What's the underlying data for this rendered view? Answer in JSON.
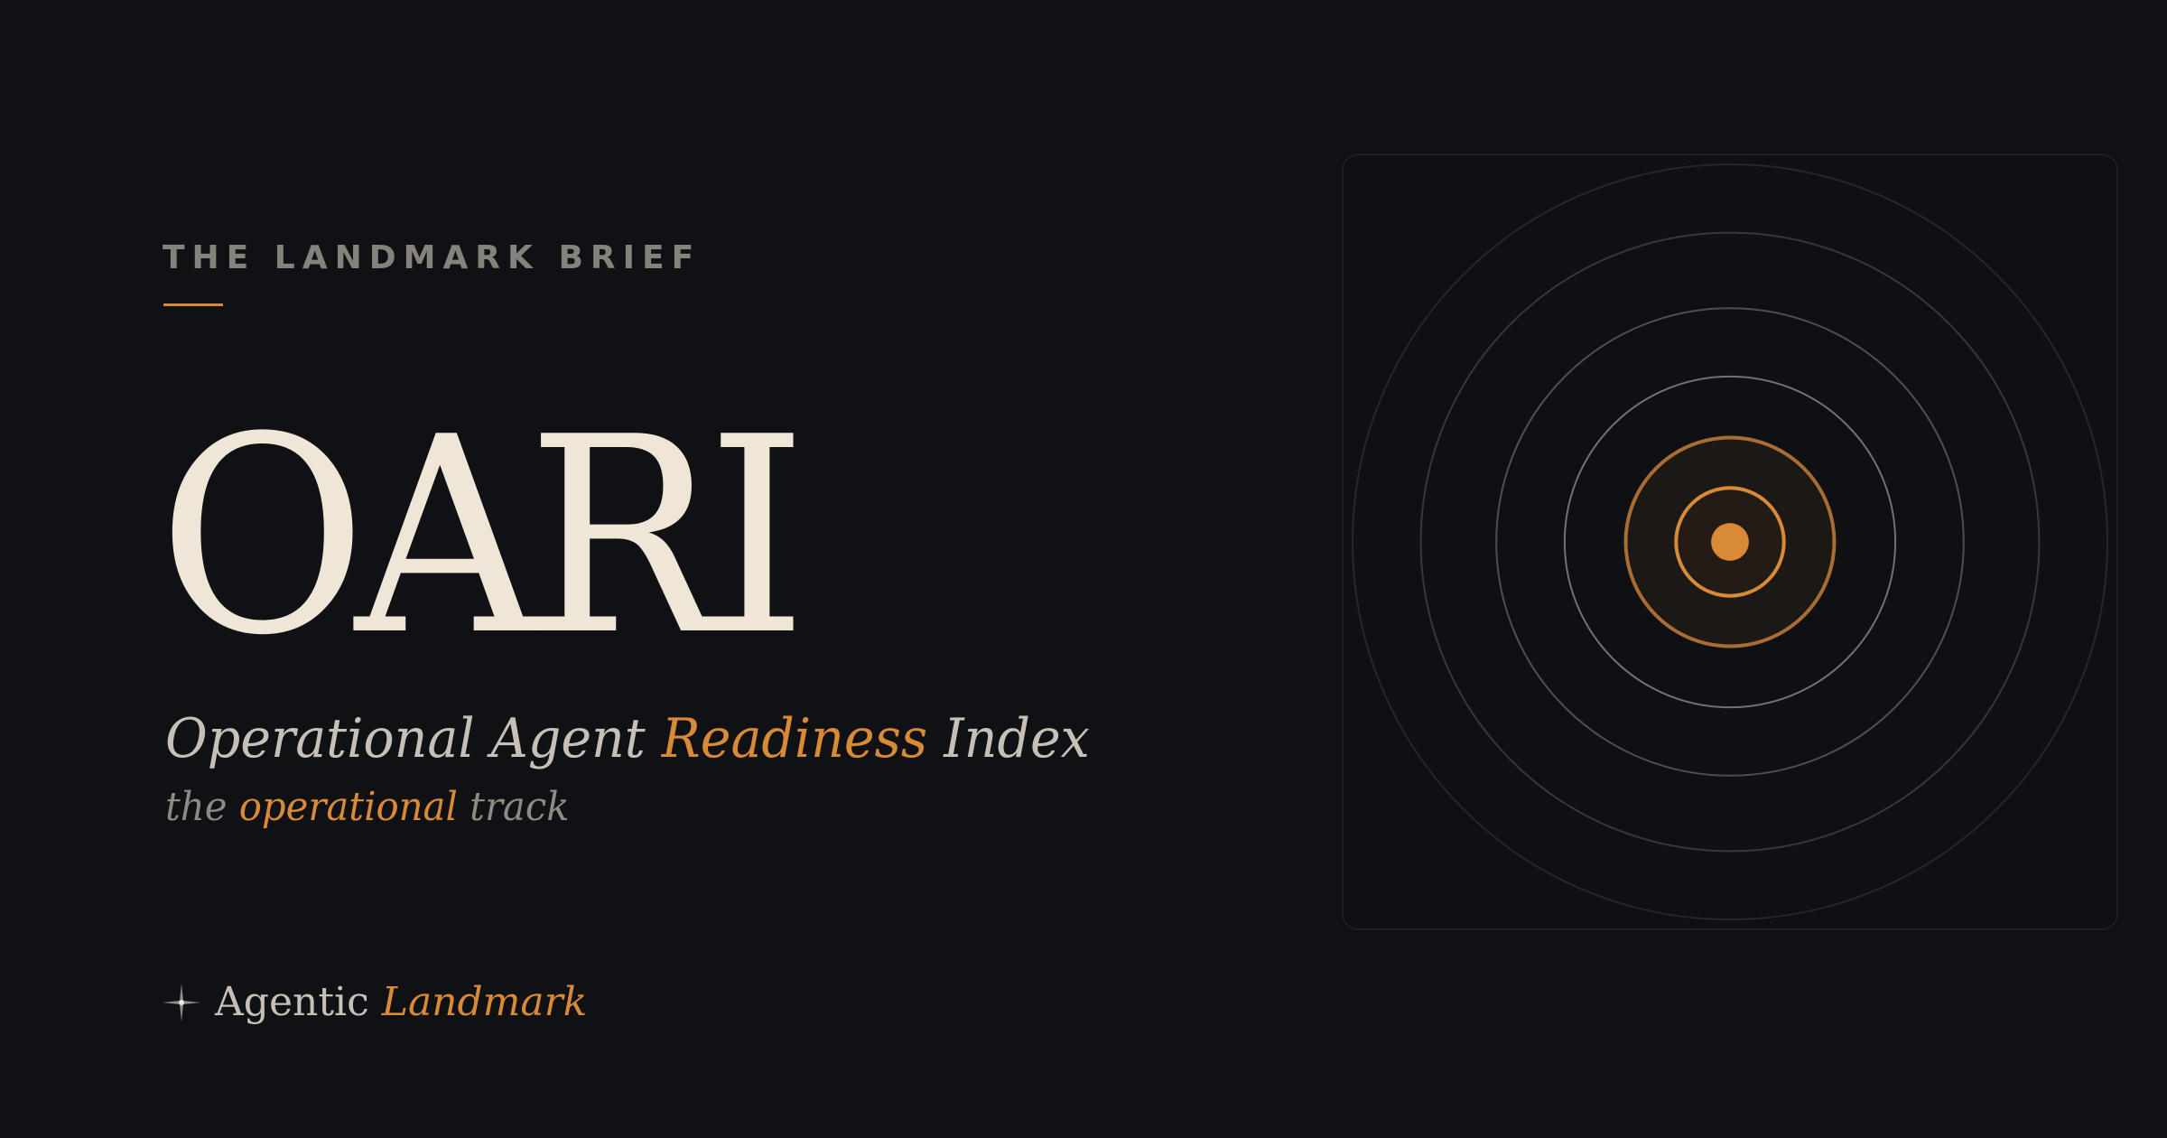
{
  "eyebrow": "THE LANDMARK BRIEF",
  "headline": "OARI",
  "subtitle": {
    "part1": "Operational Agent ",
    "accent": "Readiness",
    "part2": " Index"
  },
  "tagline": {
    "part1": "the ",
    "accent": "operational",
    "part2": " track"
  },
  "brand": {
    "icon": "sparkle-star-icon",
    "name": "Agentic",
    "accent": "Landmark"
  },
  "graphic": {
    "icon": "concentric-target-icon"
  },
  "colors": {
    "background": "#101114",
    "accent": "#d98a37",
    "headline": "#f0e6d8",
    "text": "#c6c0b7",
    "muted": "#85827c"
  }
}
